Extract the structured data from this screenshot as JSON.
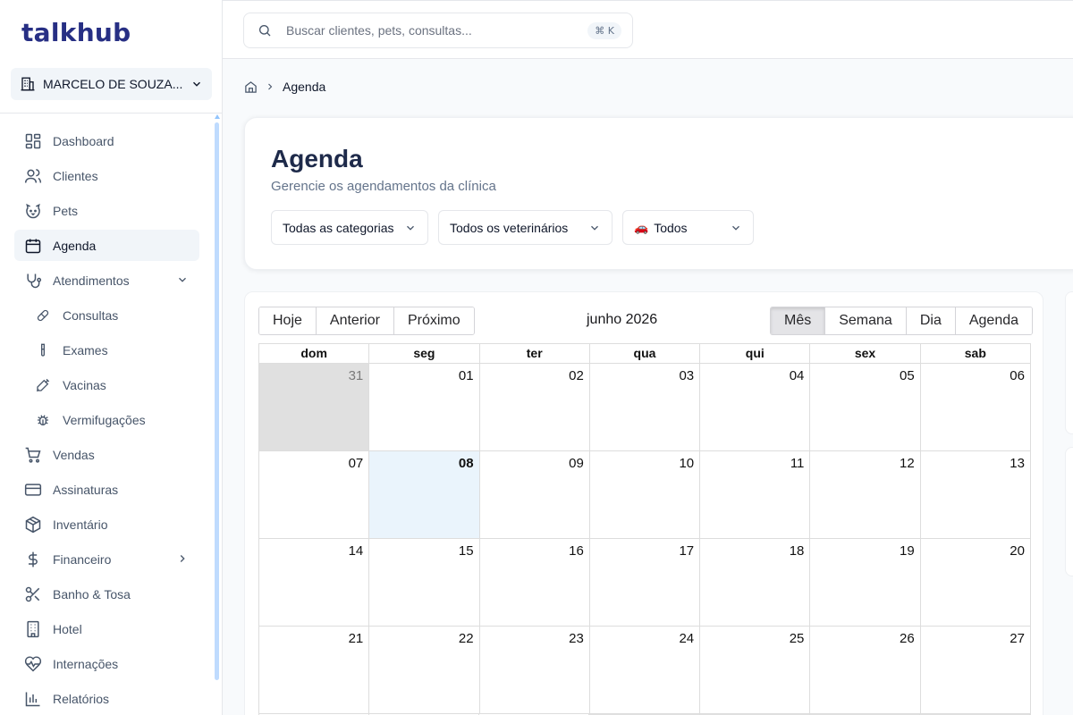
{
  "brand": {
    "logo": "talkhub",
    "color": "#272f84"
  },
  "org": {
    "name": "MARCELO DE SOUZA..."
  },
  "sidebar": {
    "items": [
      {
        "label": "Dashboard",
        "icon": "dashboard-icon"
      },
      {
        "label": "Clientes",
        "icon": "users-icon"
      },
      {
        "label": "Pets",
        "icon": "paw-icon"
      },
      {
        "label": "Agenda",
        "icon": "calendar-icon",
        "active": true
      },
      {
        "label": "Atendimentos",
        "icon": "stethoscope-icon",
        "expanded": true
      },
      {
        "label": "Consultas",
        "icon": "pill-icon",
        "sub": true
      },
      {
        "label": "Exames",
        "icon": "test-tube-icon",
        "sub": true
      },
      {
        "label": "Vacinas",
        "icon": "syringe-icon",
        "sub": true
      },
      {
        "label": "Vermifugações",
        "icon": "bug-icon",
        "sub": true
      },
      {
        "label": "Vendas",
        "icon": "cart-icon"
      },
      {
        "label": "Assinaturas",
        "icon": "credit-card-icon"
      },
      {
        "label": "Inventário",
        "icon": "box-icon"
      },
      {
        "label": "Financeiro",
        "icon": "dollar-icon",
        "collapsed": true
      },
      {
        "label": "Banho & Tosa",
        "icon": "scissors-icon"
      },
      {
        "label": "Hotel",
        "icon": "building-icon"
      },
      {
        "label": "Internações",
        "icon": "heart-pulse-icon"
      },
      {
        "label": "Relatórios",
        "icon": "bar-chart-icon"
      }
    ]
  },
  "search": {
    "placeholder": "Buscar clientes, pets, consultas...",
    "shortcut": "⌘ K"
  },
  "breadcrumb": {
    "current": "Agenda"
  },
  "header": {
    "title": "Agenda",
    "subtitle": "Gerencie os agendamentos da clínica",
    "filters": {
      "category": "Todas as categorias",
      "vet": "Todos os veterinários",
      "type": "Todos",
      "type_emoji": "🚗"
    }
  },
  "calendar": {
    "nav": {
      "today": "Hoje",
      "prev": "Anterior",
      "next": "Próximo"
    },
    "title": "junho 2026",
    "views": {
      "month": "Mês",
      "week": "Semana",
      "day": "Dia",
      "agenda": "Agenda",
      "active": "month"
    },
    "weekdays": [
      "dom",
      "seg",
      "ter",
      "qua",
      "qui",
      "sex",
      "sab"
    ],
    "weeks": [
      [
        "31",
        "01",
        "02",
        "03",
        "04",
        "05",
        "06"
      ],
      [
        "07",
        "08",
        "09",
        "10",
        "11",
        "12",
        "13"
      ],
      [
        "14",
        "15",
        "16",
        "17",
        "18",
        "19",
        "20"
      ],
      [
        "21",
        "22",
        "23",
        "24",
        "25",
        "26",
        "27"
      ]
    ],
    "today": "08"
  }
}
